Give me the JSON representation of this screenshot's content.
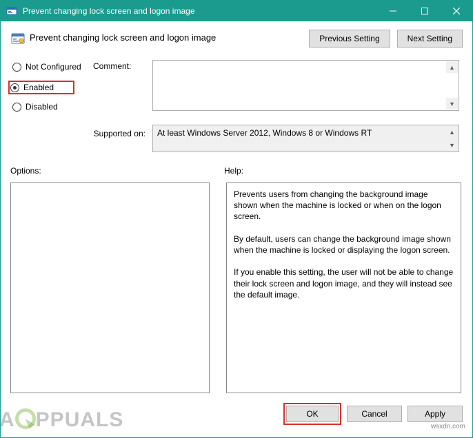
{
  "window": {
    "title": "Prevent changing lock screen and logon image"
  },
  "header": {
    "title": "Prevent changing lock screen and logon image",
    "prev_btn": "Previous Setting",
    "next_btn": "Next Setting"
  },
  "radios": {
    "not_configured": "Not Configured",
    "enabled": "Enabled",
    "disabled": "Disabled"
  },
  "labels": {
    "comment": "Comment:",
    "supported": "Supported on:",
    "options": "Options:",
    "help": "Help:"
  },
  "supported_text": "At least Windows Server 2012, Windows 8 or Windows RT",
  "help_text": "Prevents users from changing the background image shown when the machine is locked or when on the logon screen.\n\nBy default, users can change the background image shown when the machine is locked or displaying the logon screen.\n\nIf you enable this setting, the user will not be able to change their lock screen and logon image, and they will instead see the default image.",
  "footer": {
    "ok": "OK",
    "cancel": "Cancel",
    "apply": "Apply"
  },
  "watermark": "wsxdn.com",
  "brand": "PPUALS"
}
